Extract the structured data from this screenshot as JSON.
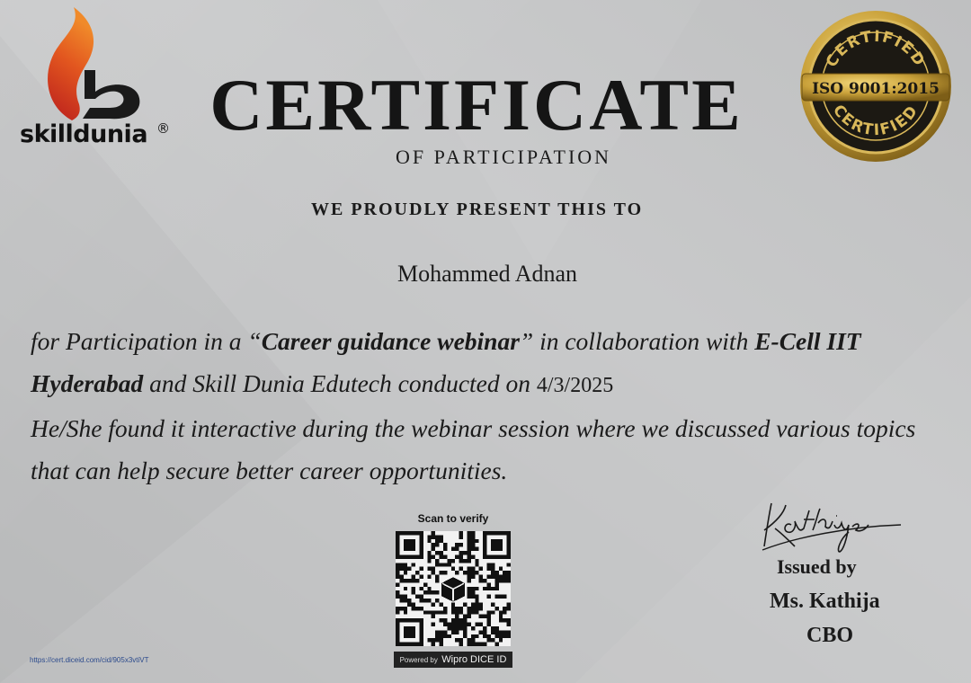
{
  "logo": {
    "wordmark": "skilldunia",
    "registered": "®"
  },
  "title": "CERTIFICATE",
  "subtitle": "OF PARTICIPATION",
  "present_line": "WE PROUDLY PRESENT THIS TO",
  "recipient": "Mohammed Adnan",
  "body": {
    "p1": "for Participation in a  “",
    "event": "Career guidance webinar",
    "p2": "”  in collaboration with ",
    "org1": "E-Cell IIT Hyderabad",
    "p3": " and Skill Dunia Edutech conducted on  ",
    "date": "4/3/2025",
    "p4": "He/She found it interactive during the webinar session where we discussed various topics that can help secure better career opportunities."
  },
  "seal": {
    "top": "CERTIFIED",
    "center": "ISO 9001:2015",
    "bottom": "CERTIFIED"
  },
  "verify": {
    "scan_label": "Scan to verify",
    "powered_label": "Powered by",
    "powered_brand": "Wipro DICE ID",
    "url": "https://cert.diceid.com/cid/905x3vtiVT"
  },
  "issuer": {
    "issued_by": "Issued by",
    "name": "Ms. Kathija",
    "role": "CBO",
    "signature": "Kathija"
  },
  "colors": {
    "background": "#c5c6c7",
    "flame_orange": "#e2561f",
    "flame_red": "#c21f1f",
    "seal_gold": "#c9a13a",
    "seal_dark": "#1a1712"
  }
}
